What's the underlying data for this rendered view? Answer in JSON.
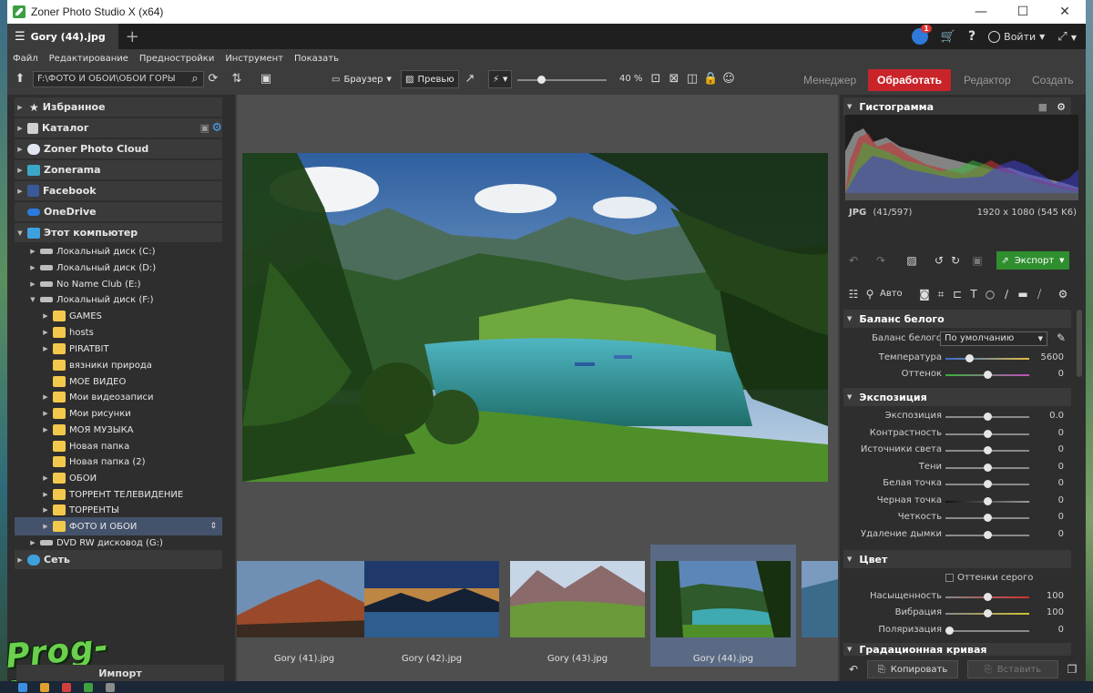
{
  "window": {
    "title": "Zoner Photo Studio X (x64)",
    "minimize": "—",
    "maximize": "☐",
    "close": "✕"
  },
  "tab": {
    "label": "Gory (44).jpg",
    "add": "+"
  },
  "account": {
    "login": "Войти",
    "badge": "1",
    "help": "?",
    "cart": "🛒"
  },
  "menu": [
    "Файл",
    "Редактирование",
    "Предностройки",
    "Инструмент",
    "Показать"
  ],
  "toolbar": {
    "path": "F:\\ФОТО И ОБОИ\\ОБОИ ГОРЫ",
    "browser": "Браузер",
    "preview": "Превью",
    "zoom": "40 %"
  },
  "workspaces": {
    "manager": "Менеджер",
    "develop": "Обработать",
    "editor": "Редактор",
    "create": "Создать"
  },
  "navigator": {
    "top": [
      "Избранное",
      "Каталог",
      "Zoner Photo Cloud",
      "Zonerama",
      "Facebook",
      "OneDrive",
      "Этот компьютер"
    ],
    "drives": [
      "Локальный диск (C:)",
      "Локальный диск (D:)",
      "No Name Club (E:)",
      "Локальный диск (F:)"
    ],
    "folders": [
      "GAMES",
      "hosts",
      "PIRATBIT",
      "вязники природа",
      "МОЕ ВИДЕО",
      "Мои видеозаписи",
      "Мои рисунки",
      "МОЯ МУЗЫКА",
      "Новая папка",
      "Новая папка (2)",
      "ОБОИ",
      "ТОРРЕНТ ТЕЛЕВИДЕНИЕ",
      "ТОРРЕНТЫ",
      "ФОТО И ОБОИ"
    ],
    "dvd": "DVD RW дисковод (G:)",
    "network": "Сеть",
    "import": "Импорт"
  },
  "watermark": "Prog-Top.net",
  "filmstrip": [
    "Gory (41).jpg",
    "Gory (42).jpg",
    "Gory (43).jpg",
    "Gory (44).jpg"
  ],
  "histogram": {
    "title": "Гистограмма",
    "format": "JPG",
    "index": "(41/597)",
    "size": "1920 x 1080 (545 K6)"
  },
  "actions": {
    "export": "Экспорт",
    "auto": "Авто",
    "copy": "Копировать",
    "paste": "Вставить"
  },
  "white_balance": {
    "title": "Баланс белого",
    "wb_label": "Баланс белого",
    "wb_value": "По умолчанию",
    "temperature_label": "Температура",
    "temperature_value": "5600",
    "tint_label": "Оттенок",
    "tint_value": "0"
  },
  "exposure": {
    "title": "Экспозиция",
    "rows": [
      {
        "label": "Экспозиция",
        "value": "0.0"
      },
      {
        "label": "Контрастность",
        "value": "0"
      },
      {
        "label": "Источники света",
        "value": "0"
      },
      {
        "label": "Тени",
        "value": "0"
      },
      {
        "label": "Белая точка",
        "value": "0"
      },
      {
        "label": "Черная точка",
        "value": "0"
      },
      {
        "label": "Четкость",
        "value": "0"
      },
      {
        "label": "Удаление дымки",
        "value": "0"
      }
    ]
  },
  "color": {
    "title": "Цвет",
    "grayscale": "Оттенки серого",
    "rows": [
      {
        "label": "Насыщенность",
        "value": "100"
      },
      {
        "label": "Вибрация",
        "value": "100"
      },
      {
        "label": "Поляризация",
        "value": "0"
      }
    ]
  },
  "curve": {
    "title": "Градационная кривая"
  },
  "colors": {
    "develop_active": "#c8242a",
    "export": "#2f8f2f",
    "selection": "#44536b",
    "folder": "#f2c94c"
  }
}
